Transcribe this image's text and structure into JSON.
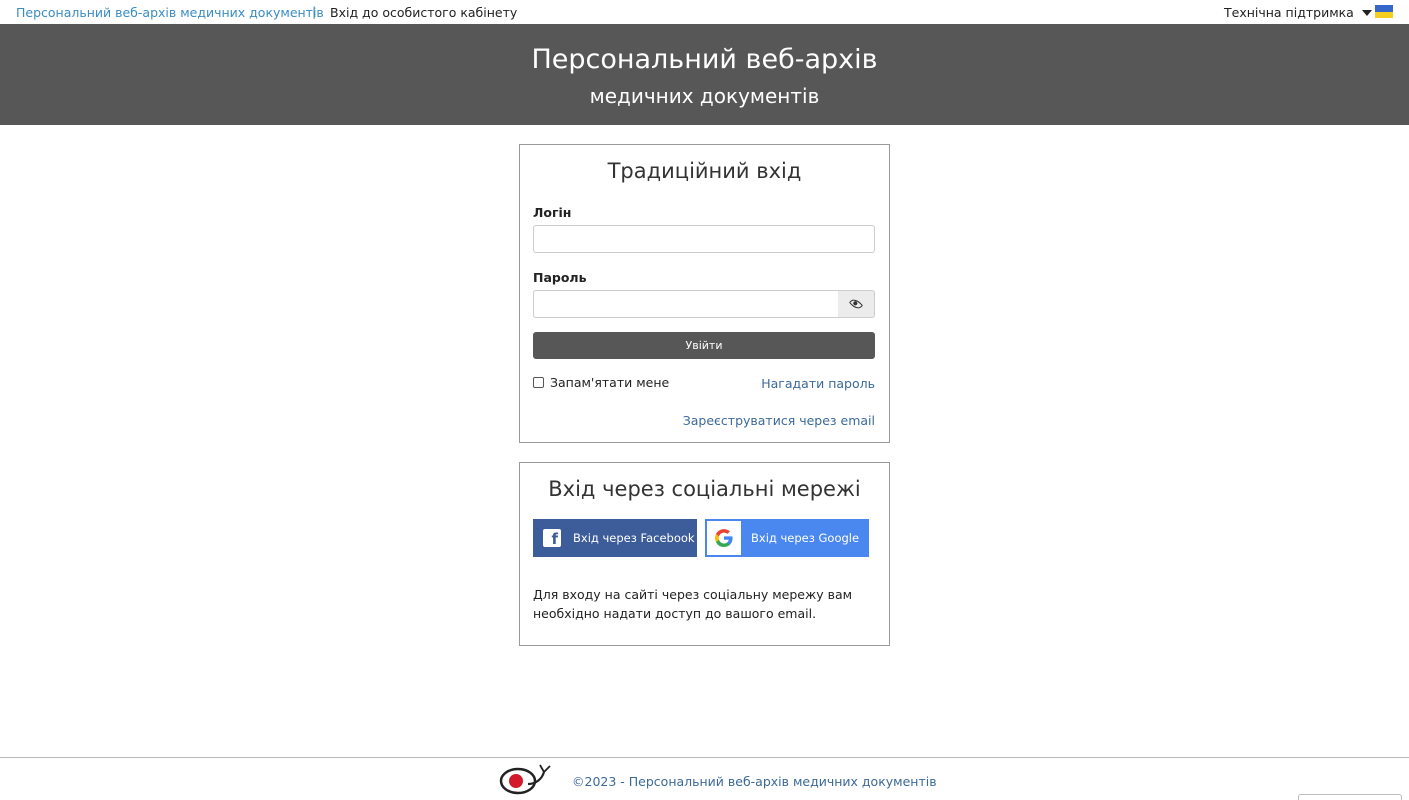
{
  "topbar": {
    "brand": "Персональний веб-архів медичних документів",
    "separator": "|",
    "cabinet_link": "Вхід до особистого кабінету",
    "support_label": "Технічна підтримка"
  },
  "hero": {
    "line1": "Персональний веб-архів",
    "line2": "медичних документів"
  },
  "login": {
    "title": "Традиційний вхід",
    "login_label": "Логін",
    "password_label": "Пароль",
    "submit_label": "Увійти",
    "remember_label": "Запам'ятати мене",
    "forgot_link": "Нагадати пароль",
    "register_link": "Зареєструватися через email"
  },
  "social": {
    "title": "Вхід через соціальні мережі",
    "facebook_label": "Вхід через Facebook",
    "google_label": "Вхід через Google",
    "note": "Для входу на сайті через соціальну мережу вам необхідно надати доступ до вашого email."
  },
  "footer": {
    "copyright": "©2023 - Персональний веб-архів медичних документів"
  },
  "colors": {
    "header_bg": "#575757",
    "link": "#3b6a9a",
    "facebook": "#3d5c9a",
    "google": "#4a87ee"
  },
  "icons": [
    "chevron-down-icon",
    "ukraine-flag-icon",
    "eye-icon",
    "facebook-icon",
    "google-icon",
    "logo-stethoscope-icon"
  ]
}
